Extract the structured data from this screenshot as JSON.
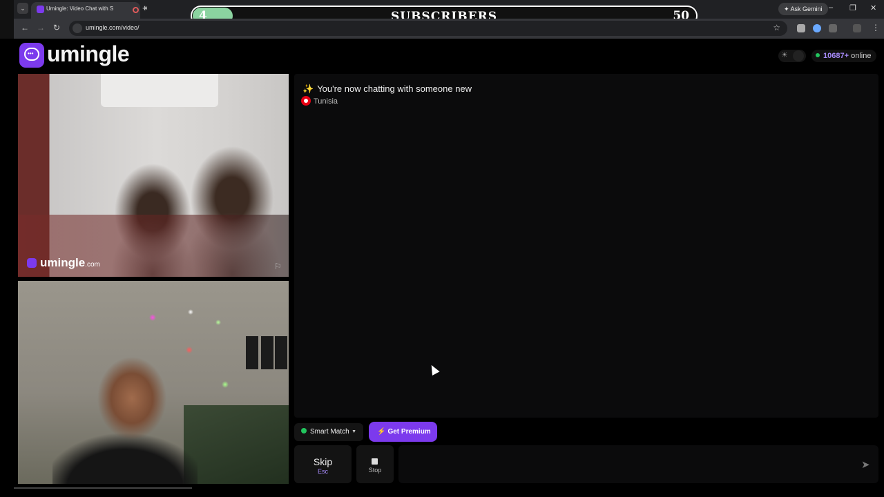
{
  "browser": {
    "tab_title": "Umingle: Video Chat with S",
    "url": "umingle.com/video/",
    "ask_gemini_label": "Ask Gemini",
    "new_tab_glyph": "+",
    "close_tab_glyph": "×"
  },
  "overlay": {
    "current": "4",
    "label": "SUBSCRIBERS",
    "goal": "50",
    "progress_fraction": 0.08,
    "fill_color": "#8bd3a0"
  },
  "site": {
    "logo_text": "umingle",
    "brand_color": "#7c3aed"
  },
  "status": {
    "online_count": "10687+",
    "online_label": "online"
  },
  "stranger_video": {
    "watermark_text": "umingle",
    "watermark_domain": ".com"
  },
  "chat": {
    "system_message": "You're now chatting with someone new",
    "country": "Tunisia",
    "message_placeholder": ""
  },
  "controls": {
    "smart_match_label": "Smart Match",
    "premium_label": "Get Premium",
    "skip_label": "Skip",
    "skip_key": "Esc",
    "stop_label": "Stop"
  },
  "icons": {
    "theme": "sun-icon",
    "send": "send-icon",
    "report": "flag-icon"
  }
}
